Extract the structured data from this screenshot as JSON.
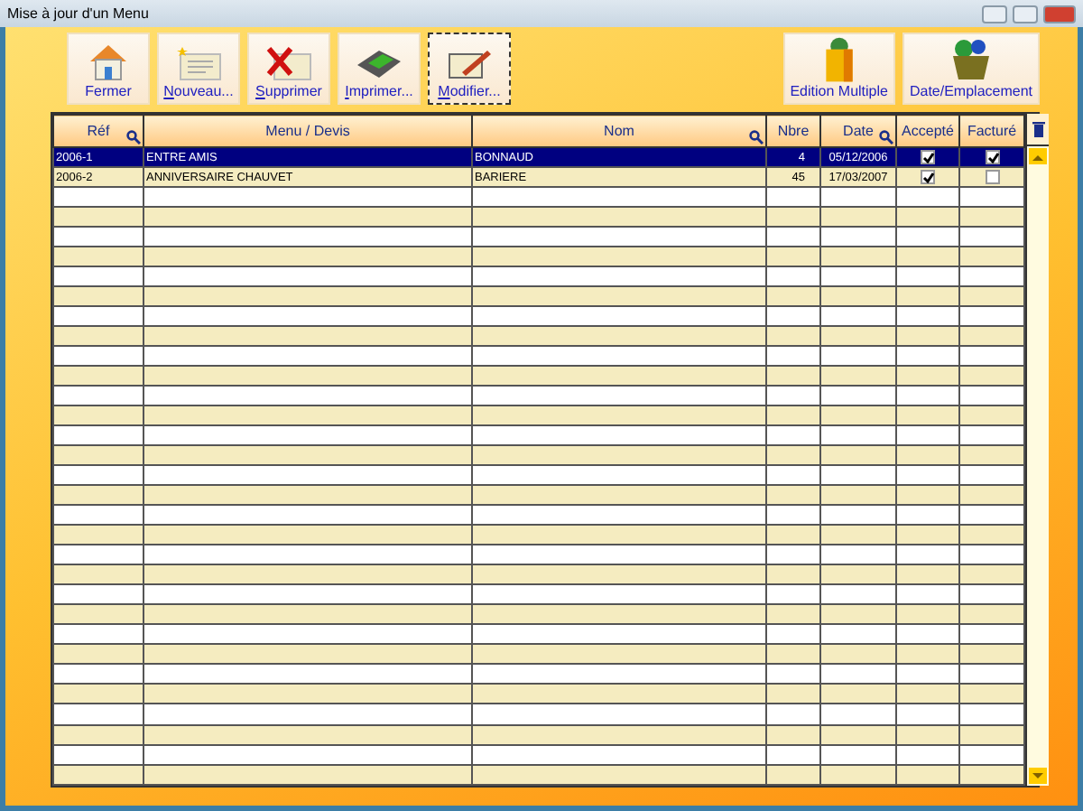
{
  "window": {
    "title": "Mise à jour d'un Menu"
  },
  "toolbar_left": [
    {
      "label": "Fermer",
      "underline_first": false,
      "focused": false
    },
    {
      "label": "Nouveau...",
      "underline_first": true,
      "focused": false
    },
    {
      "label": "Supprimer",
      "underline_first": true,
      "focused": false
    },
    {
      "label": "Imprimer...",
      "underline_first": true,
      "focused": false
    },
    {
      "label": "Modifier...",
      "underline_first": true,
      "focused": true
    }
  ],
  "toolbar_right": [
    {
      "label": "Edition Multiple",
      "underline_first": false,
      "focused": false
    },
    {
      "label": "Date/Emplacement",
      "underline_first": false,
      "focused": false
    }
  ],
  "table": {
    "columns": [
      {
        "label": "Réf",
        "sortable": true
      },
      {
        "label": "Menu / Devis",
        "sortable": false
      },
      {
        "label": "Nom",
        "sortable": true
      },
      {
        "label": "Nbre",
        "sortable": false
      },
      {
        "label": "Date",
        "sortable": true
      },
      {
        "label": "Accepté",
        "sortable": false
      },
      {
        "label": "Facturé",
        "sortable": false
      }
    ],
    "rows": [
      {
        "ref": "2006-1",
        "menu": "ENTRE AMIS",
        "nom": "BONNAUD",
        "nbre": "4",
        "date": "05/12/2006",
        "accepte": true,
        "facture": true,
        "selected": true
      },
      {
        "ref": "2006-2",
        "menu": "ANNIVERSAIRE CHAUVET",
        "nom": "BARIERE",
        "nbre": "45",
        "date": "17/03/2007",
        "accepte": true,
        "facture": false,
        "selected": false
      }
    ]
  }
}
